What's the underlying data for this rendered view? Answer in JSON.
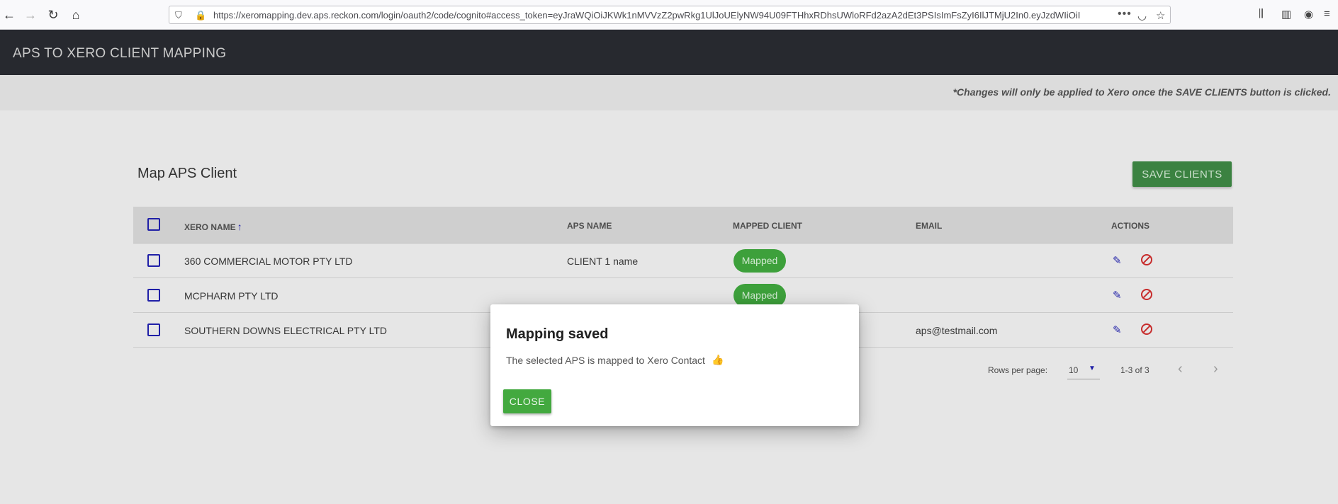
{
  "browser": {
    "url": "https://xeromapping.dev.aps.reckon.com/login/oauth2/code/cognito#access_token=eyJraWQiOiJKWk1nMVVzZ2pwRkg1UlJoUElyNW94U09FTHhxRDhsUWloRFd2azA2dEt3PSIsImFsZyI6IlJTMjU2In0.eyJzdWIiOiI"
  },
  "header": {
    "title": "APS TO XERO CLIENT MAPPING"
  },
  "notice": {
    "text": "*Changes will only be applied to Xero once the SAVE CLIENTS button is clicked."
  },
  "card": {
    "title": "Map APS Client",
    "save_label": "SAVE CLIENTS"
  },
  "table": {
    "columns": {
      "xero_name": "XERO NAME",
      "aps_name": "APS NAME",
      "mapped_client": "MAPPED CLIENT",
      "email": "EMAIL",
      "actions": "ACTIONS"
    },
    "rows": [
      {
        "xero_name": "360 COMMERCIAL MOTOR PTY LTD",
        "aps_name": "CLIENT 1 name",
        "mapped": "Mapped",
        "email": ""
      },
      {
        "xero_name": "MCPHARM PTY LTD",
        "aps_name": "",
        "mapped": "Mapped",
        "email": ""
      },
      {
        "xero_name": "SOUTHERN DOWNS ELECTRICAL PTY LTD",
        "aps_name": "",
        "mapped": "",
        "email": "aps@testmail.com"
      }
    ]
  },
  "pagination": {
    "rows_per_page_label": "Rows per page:",
    "rows_per_page": "10",
    "range": "1-3 of 3"
  },
  "dialog": {
    "title": "Mapping saved",
    "message": "The selected APS is mapped to Xero Contact",
    "close_label": "CLOSE"
  },
  "colors": {
    "header_bg": "#23252b",
    "accent_green": "#3a9f38",
    "checkbox_blue": "#1b1ba6",
    "delete_red": "#c62828"
  }
}
